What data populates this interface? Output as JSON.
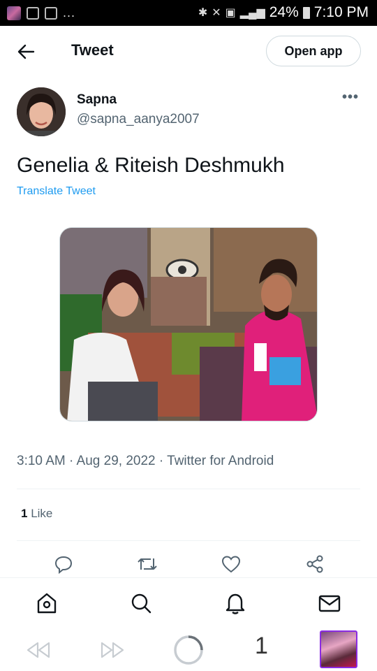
{
  "status_bar": {
    "battery": "24%",
    "time": "7:10 PM",
    "overflow": "..."
  },
  "header": {
    "title": "Tweet",
    "open_app_label": "Open app"
  },
  "tweet": {
    "author_name": "Sapna",
    "author_handle": "@sapna_aanya2007",
    "text": "Genelia & Riteish Deshmukh",
    "translate_label": "Translate Tweet",
    "timestamp_line": "3:10 AM · Aug 29, 2022 · Twitter for Android",
    "like_count": "1",
    "like_label": "Like"
  },
  "actions": [
    "reply-icon",
    "retweet-icon",
    "like-icon",
    "share-icon"
  ],
  "bottom_tabs": [
    "home-icon",
    "search-icon",
    "notifications-icon",
    "messages-icon"
  ],
  "browser": {
    "tab_count": "1"
  },
  "colors": {
    "accent": "#1d9bf0",
    "text": "#0f1419",
    "secondary": "#536471"
  }
}
